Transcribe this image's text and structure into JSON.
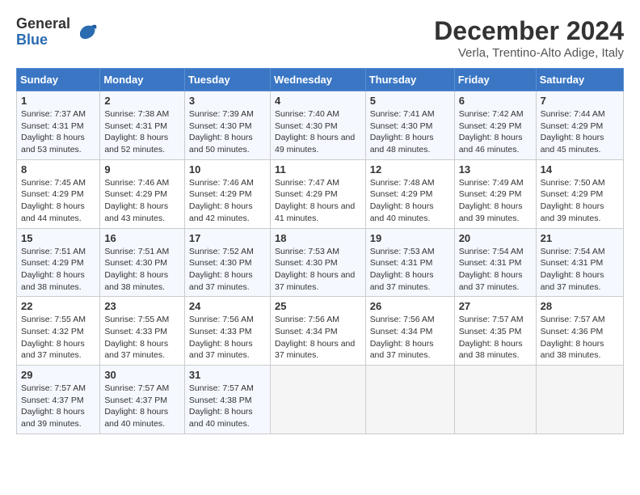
{
  "logo": {
    "general": "General",
    "blue": "Blue"
  },
  "title": "December 2024",
  "subtitle": "Verla, Trentino-Alto Adige, Italy",
  "days_header": [
    "Sunday",
    "Monday",
    "Tuesday",
    "Wednesday",
    "Thursday",
    "Friday",
    "Saturday"
  ],
  "weeks": [
    [
      {
        "day": "1",
        "sunrise": "7:37 AM",
        "sunset": "4:31 PM",
        "daylight": "8 hours and 53 minutes."
      },
      {
        "day": "2",
        "sunrise": "7:38 AM",
        "sunset": "4:31 PM",
        "daylight": "8 hours and 52 minutes."
      },
      {
        "day": "3",
        "sunrise": "7:39 AM",
        "sunset": "4:30 PM",
        "daylight": "8 hours and 50 minutes."
      },
      {
        "day": "4",
        "sunrise": "7:40 AM",
        "sunset": "4:30 PM",
        "daylight": "8 hours and 49 minutes."
      },
      {
        "day": "5",
        "sunrise": "7:41 AM",
        "sunset": "4:30 PM",
        "daylight": "8 hours and 48 minutes."
      },
      {
        "day": "6",
        "sunrise": "7:42 AM",
        "sunset": "4:29 PM",
        "daylight": "8 hours and 46 minutes."
      },
      {
        "day": "7",
        "sunrise": "7:44 AM",
        "sunset": "4:29 PM",
        "daylight": "8 hours and 45 minutes."
      }
    ],
    [
      {
        "day": "8",
        "sunrise": "7:45 AM",
        "sunset": "4:29 PM",
        "daylight": "8 hours and 44 minutes."
      },
      {
        "day": "9",
        "sunrise": "7:46 AM",
        "sunset": "4:29 PM",
        "daylight": "8 hours and 43 minutes."
      },
      {
        "day": "10",
        "sunrise": "7:46 AM",
        "sunset": "4:29 PM",
        "daylight": "8 hours and 42 minutes."
      },
      {
        "day": "11",
        "sunrise": "7:47 AM",
        "sunset": "4:29 PM",
        "daylight": "8 hours and 41 minutes."
      },
      {
        "day": "12",
        "sunrise": "7:48 AM",
        "sunset": "4:29 PM",
        "daylight": "8 hours and 40 minutes."
      },
      {
        "day": "13",
        "sunrise": "7:49 AM",
        "sunset": "4:29 PM",
        "daylight": "8 hours and 39 minutes."
      },
      {
        "day": "14",
        "sunrise": "7:50 AM",
        "sunset": "4:29 PM",
        "daylight": "8 hours and 39 minutes."
      }
    ],
    [
      {
        "day": "15",
        "sunrise": "7:51 AM",
        "sunset": "4:29 PM",
        "daylight": "8 hours and 38 minutes."
      },
      {
        "day": "16",
        "sunrise": "7:51 AM",
        "sunset": "4:30 PM",
        "daylight": "8 hours and 38 minutes."
      },
      {
        "day": "17",
        "sunrise": "7:52 AM",
        "sunset": "4:30 PM",
        "daylight": "8 hours and 37 minutes."
      },
      {
        "day": "18",
        "sunrise": "7:53 AM",
        "sunset": "4:30 PM",
        "daylight": "8 hours and 37 minutes."
      },
      {
        "day": "19",
        "sunrise": "7:53 AM",
        "sunset": "4:31 PM",
        "daylight": "8 hours and 37 minutes."
      },
      {
        "day": "20",
        "sunrise": "7:54 AM",
        "sunset": "4:31 PM",
        "daylight": "8 hours and 37 minutes."
      },
      {
        "day": "21",
        "sunrise": "7:54 AM",
        "sunset": "4:31 PM",
        "daylight": "8 hours and 37 minutes."
      }
    ],
    [
      {
        "day": "22",
        "sunrise": "7:55 AM",
        "sunset": "4:32 PM",
        "daylight": "8 hours and 37 minutes."
      },
      {
        "day": "23",
        "sunrise": "7:55 AM",
        "sunset": "4:33 PM",
        "daylight": "8 hours and 37 minutes."
      },
      {
        "day": "24",
        "sunrise": "7:56 AM",
        "sunset": "4:33 PM",
        "daylight": "8 hours and 37 minutes."
      },
      {
        "day": "25",
        "sunrise": "7:56 AM",
        "sunset": "4:34 PM",
        "daylight": "8 hours and 37 minutes."
      },
      {
        "day": "26",
        "sunrise": "7:56 AM",
        "sunset": "4:34 PM",
        "daylight": "8 hours and 37 minutes."
      },
      {
        "day": "27",
        "sunrise": "7:57 AM",
        "sunset": "4:35 PM",
        "daylight": "8 hours and 38 minutes."
      },
      {
        "day": "28",
        "sunrise": "7:57 AM",
        "sunset": "4:36 PM",
        "daylight": "8 hours and 38 minutes."
      }
    ],
    [
      {
        "day": "29",
        "sunrise": "7:57 AM",
        "sunset": "4:37 PM",
        "daylight": "8 hours and 39 minutes."
      },
      {
        "day": "30",
        "sunrise": "7:57 AM",
        "sunset": "4:37 PM",
        "daylight": "8 hours and 40 minutes."
      },
      {
        "day": "31",
        "sunrise": "7:57 AM",
        "sunset": "4:38 PM",
        "daylight": "8 hours and 40 minutes."
      },
      null,
      null,
      null,
      null
    ]
  ]
}
